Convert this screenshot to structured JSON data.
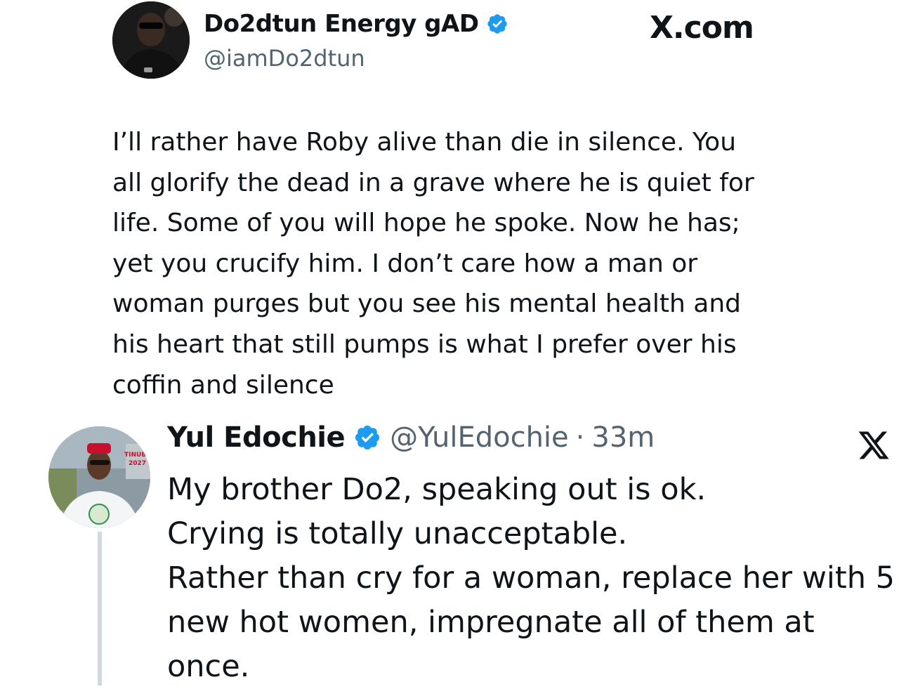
{
  "tweet1": {
    "display_name": "Do2dtun Energy gAD",
    "handle": "@iamDo2dtun",
    "verified": true,
    "site_label": "X.com",
    "text": "I’ll rather have Roby alive than die in silence. You\nall glorify the dead in a grave where he is quiet for\nlife. Some of you will hope he spoke. Now he has;\nyet you crucify him. I don’t care how a man or\nwoman purges but you see his mental health and\nhis heart that still pumps is what I prefer over his\ncoffin and silence"
  },
  "tweet2": {
    "display_name": "Yul Edochie",
    "handle": "@YulEdochie",
    "separator": "·",
    "time": "33m",
    "verified": true,
    "avatar_cap_text": "TINUBU",
    "avatar_year_text": "2027",
    "text": "My brother Do2, speaking out is ok.\nCrying is totally unacceptable.\nRather than cry for a woman, replace her with 5\nnew hot women, impregnate all of them at\nonce."
  },
  "icons": {
    "verified": "verified-badge-icon",
    "x_logo": "x-logo-icon"
  },
  "colors": {
    "verified_blue": "#1d9bf0",
    "secondary_text": "#536471",
    "thread_line": "#cfd9de"
  }
}
